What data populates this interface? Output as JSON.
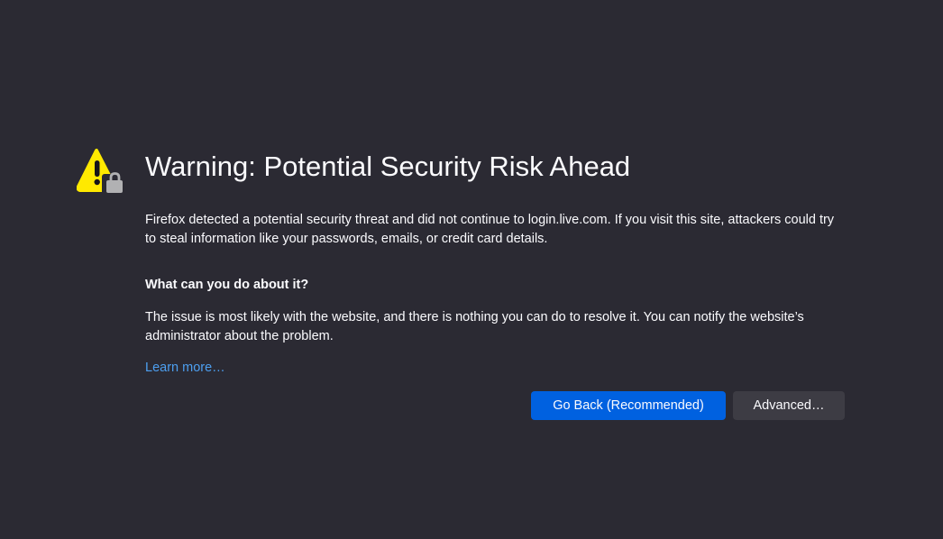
{
  "page": {
    "title": "Warning: Potential Security Risk Ahead",
    "intro": "Firefox detected a potential security threat and did not continue to login.live.com. If you visit this site, attackers could try to steal information like your passwords, emails, or credit card details.",
    "subheading": "What can you do about it?",
    "issue": "The issue is most likely with the website, and there is nothing you can do to resolve it. You can notify the website’s administrator about the problem.",
    "learn_more": "Learn more…"
  },
  "buttons": {
    "go_back": "Go Back (Recommended)",
    "advanced": "Advanced…"
  },
  "icons": {
    "warning": "warning-lock-icon"
  },
  "colors": {
    "background": "#2b2a33",
    "text": "#fbfbfe",
    "link": "#4d9ff0",
    "primary_button": "#0061e0",
    "secondary_button": "#3d3c44",
    "warning_yellow": "#ffe900"
  }
}
